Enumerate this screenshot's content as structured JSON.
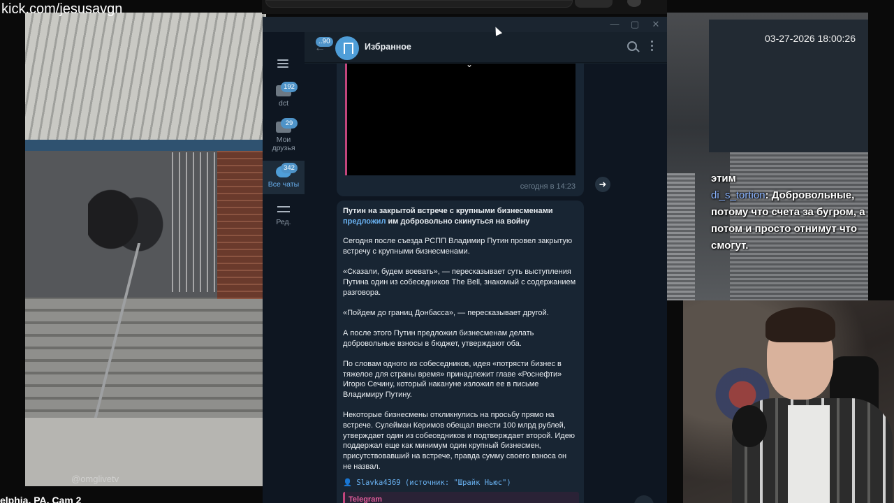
{
  "stream": {
    "url": "kick.com/jesusavgn",
    "camera_label": "elphia, PA, Cam 2",
    "camera_watermark": "@omglivetv",
    "timestamp": "03-27-2026 18:00:26"
  },
  "chat_overlay": {
    "previous_word": "этим",
    "username": "di_s_tortion",
    "message": ": Добровольные, потому что счета за бугром, а потом и просто отнимут что смогут."
  },
  "telegram": {
    "window_controls": {
      "minimize": "—",
      "maximize": "▢",
      "close": "✕"
    },
    "folders": [
      {
        "label": "dct",
        "badge": "192",
        "icon": "folder-icon"
      },
      {
        "label": "Мои друзья",
        "badge": "29",
        "icon": "folder-icon"
      },
      {
        "label": "Все чаты",
        "badge": "342",
        "icon": "chats-icon",
        "active": true
      },
      {
        "label": "Ред.",
        "badge": "",
        "icon": "edit-icon"
      }
    ],
    "header": {
      "back_badge": "..90",
      "title": "Избранное"
    },
    "video_message": {
      "time": "сегодня в 14:23"
    },
    "post": {
      "headline_bold_1": "Путин на закрытой встрече с крупными бизнесменами ",
      "headline_link": "предложил",
      "headline_bold_2": " им добровольно скинуться на войну",
      "paragraphs": [
        "Сегодня после съезда РСПП Владимир Путин провел закрытую встречу с крупными  бизнесменами.",
        "«Сказали, будем воевать», — пересказывает суть выступления Путина один из собеседников The Bell, знакомый с содержанием разговора.",
        "«Пойдем до границ Донбасса», — пересказывает другой.",
        "А после этого Путин предложил бизнесменам делать добровольные взносы в бюджет, утверждают оба.",
        "По словам одного из собеседников, идея «потрясти бизнес в тяжелое для страны время» принадлежит главе «Роснефти» Игорю Сечину, который накануне изложил ее в письме Владимиру Путину.",
        "Некоторые бизнесмены откликнулись на просьбу прямо на встрече. Сулейман Керимов обещал внести 100 млрд рублей, утверждает один из собеседников и подтверждает второй. Идею поддержал еще как минимум один крупный бизнесмен, присутствовавший на встрече, правда сумму своего взноса он не назвал."
      ],
      "author_line": "👤 Slavka4369 (источник: \"Шрайк Ньюс\")",
      "quote_label": "Telegram"
    }
  }
}
